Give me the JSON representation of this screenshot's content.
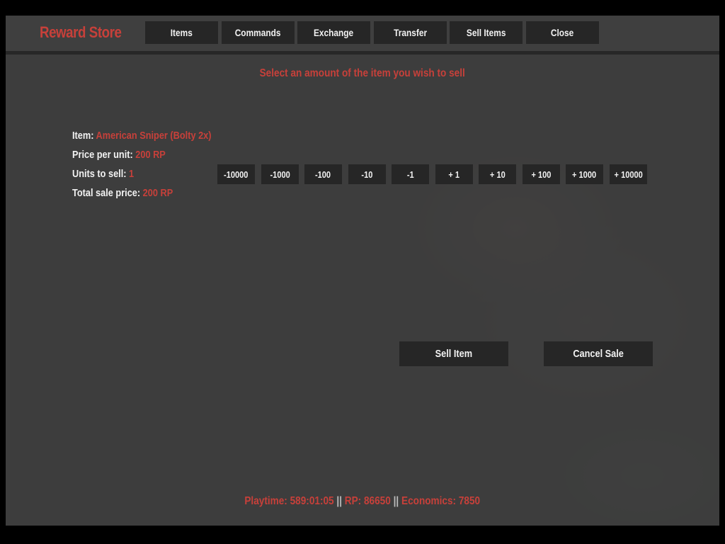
{
  "header": {
    "title": "Reward Store",
    "tabs": [
      {
        "label": "Items"
      },
      {
        "label": "Commands"
      },
      {
        "label": "Exchange"
      },
      {
        "label": "Transfer"
      },
      {
        "label": "Sell Items"
      },
      {
        "label": "Close"
      }
    ]
  },
  "prompt": "Select an amount of the item you wish to sell",
  "sale": {
    "item_label": "Item:",
    "item_value": "American Sniper (Bolty 2x)",
    "price_label": "Price per unit:",
    "price_value": "200 RP",
    "units_label": "Units to sell:",
    "units_value": "1",
    "total_label": "Total sale price:",
    "total_value": "200 RP"
  },
  "steppers": [
    {
      "label": "-10000"
    },
    {
      "label": "-1000"
    },
    {
      "label": "-100"
    },
    {
      "label": "-10"
    },
    {
      "label": "-1"
    },
    {
      "label": "+ 1"
    },
    {
      "label": "+ 10"
    },
    {
      "label": "+ 100"
    },
    {
      "label": "+ 1000"
    },
    {
      "label": "+ 10000"
    }
  ],
  "actions": {
    "sell_label": "Sell Item",
    "cancel_label": "Cancel Sale"
  },
  "footer": {
    "playtime": "Playtime: 589:01:05",
    "sep1": "||",
    "rp": "RP: 86650",
    "sep2": "||",
    "economics": "Economics: 7850"
  },
  "colors": {
    "accent": "#c7403a",
    "button_bg": "#262626",
    "text": "#f2f2f2"
  }
}
